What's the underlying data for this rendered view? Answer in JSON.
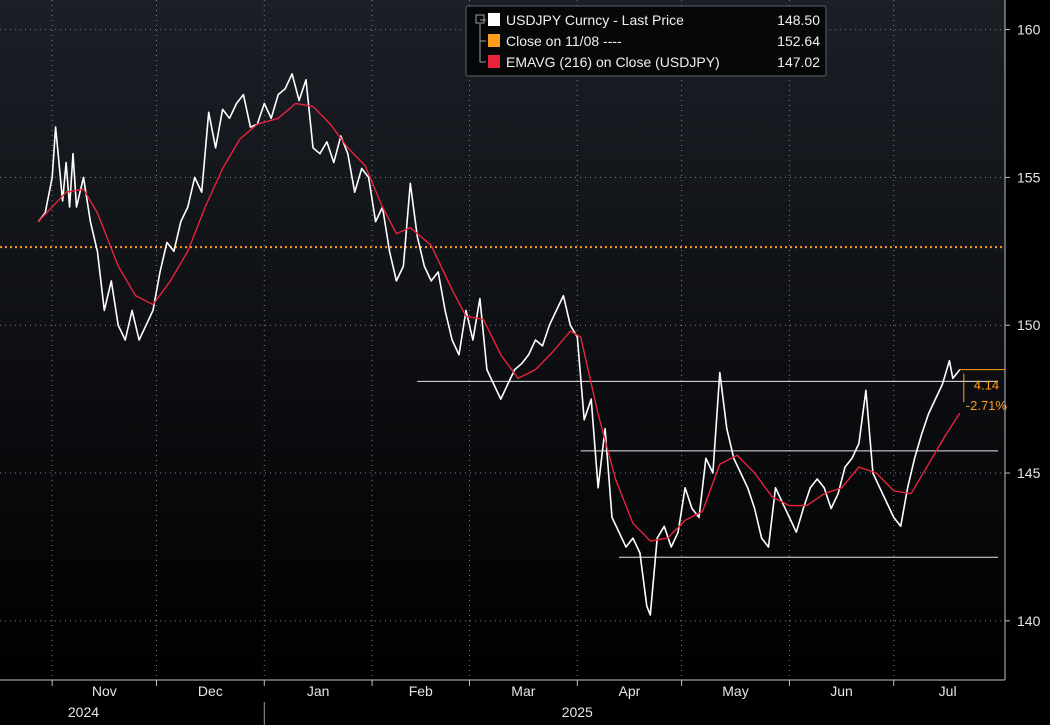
{
  "chart_data": {
    "type": "line",
    "ticker": "USDJPY",
    "ylim": [
      138,
      161
    ],
    "y_ticks": [
      140,
      145,
      150,
      155,
      160
    ],
    "month_labels": [
      "Nov",
      "Dec",
      "Jan",
      "Feb",
      "Mar",
      "Apr",
      "May",
      "Jun",
      "Jul"
    ],
    "year_labels": [
      "2024",
      "2025"
    ],
    "legend": [
      {
        "label": "USDJPY Curncy - Last Price",
        "value": "148.50",
        "color": "#ffffff"
      },
      {
        "label": "Close on 11/08 ----",
        "value": "152.64",
        "color": "#ff9e1b"
      },
      {
        "label": "EMAVG (216)  on Close (USDJPY)",
        "value": "147.02",
        "color": "#e8233c"
      }
    ],
    "annotations": {
      "change_abs": "4.14",
      "change_pct": "-2.71%"
    },
    "reference_close": 152.64,
    "support_resistance_levels": [
      148.1,
      145.75,
      142.15
    ],
    "series": [
      {
        "name": "USDJPY Curncy - Last Price",
        "color": "#ffffff",
        "points": [
          [
            "2024-10-28",
            153.5
          ],
          [
            "2024-10-30",
            153.8
          ],
          [
            "2024-11-01",
            155.0
          ],
          [
            "2024-11-02",
            156.7
          ],
          [
            "2024-11-04",
            154.2
          ],
          [
            "2024-11-05",
            155.5
          ],
          [
            "2024-11-06",
            154.0
          ],
          [
            "2024-11-07",
            155.8
          ],
          [
            "2024-11-08",
            154.0
          ],
          [
            "2024-11-10",
            155.0
          ],
          [
            "2024-11-12",
            153.5
          ],
          [
            "2024-11-14",
            152.5
          ],
          [
            "2024-11-16",
            150.5
          ],
          [
            "2024-11-18",
            151.5
          ],
          [
            "2024-11-20",
            150.0
          ],
          [
            "2024-11-22",
            149.5
          ],
          [
            "2024-11-24",
            150.5
          ],
          [
            "2024-11-26",
            149.5
          ],
          [
            "2024-11-28",
            150.0
          ],
          [
            "2024-11-30",
            150.5
          ],
          [
            "2024-12-02",
            151.8
          ],
          [
            "2024-12-04",
            152.8
          ],
          [
            "2024-12-06",
            152.5
          ],
          [
            "2024-12-08",
            153.5
          ],
          [
            "2024-12-10",
            154.0
          ],
          [
            "2024-12-12",
            155.0
          ],
          [
            "2024-12-14",
            154.5
          ],
          [
            "2024-12-16",
            157.2
          ],
          [
            "2024-12-18",
            156.0
          ],
          [
            "2024-12-20",
            157.3
          ],
          [
            "2024-12-22",
            157.0
          ],
          [
            "2024-12-24",
            157.5
          ],
          [
            "2024-12-26",
            157.8
          ],
          [
            "2024-12-28",
            156.7
          ],
          [
            "2024-12-30",
            156.8
          ],
          [
            "2025-01-01",
            157.5
          ],
          [
            "2025-01-03",
            157.0
          ],
          [
            "2025-01-05",
            157.8
          ],
          [
            "2025-01-07",
            158.0
          ],
          [
            "2025-01-09",
            158.5
          ],
          [
            "2025-01-11",
            157.6
          ],
          [
            "2025-01-13",
            158.3
          ],
          [
            "2025-01-15",
            156.0
          ],
          [
            "2025-01-17",
            155.8
          ],
          [
            "2025-01-19",
            156.2
          ],
          [
            "2025-01-21",
            155.5
          ],
          [
            "2025-01-23",
            156.4
          ],
          [
            "2025-01-25",
            155.8
          ],
          [
            "2025-01-27",
            154.5
          ],
          [
            "2025-01-29",
            155.3
          ],
          [
            "2025-01-31",
            155.0
          ],
          [
            "2025-02-02",
            153.5
          ],
          [
            "2025-02-04",
            154.0
          ],
          [
            "2025-02-06",
            152.5
          ],
          [
            "2025-02-08",
            151.5
          ],
          [
            "2025-02-10",
            152.0
          ],
          [
            "2025-02-12",
            154.8
          ],
          [
            "2025-02-14",
            153.0
          ],
          [
            "2025-02-16",
            152.0
          ],
          [
            "2025-02-18",
            151.5
          ],
          [
            "2025-02-20",
            151.8
          ],
          [
            "2025-02-22",
            150.5
          ],
          [
            "2025-02-24",
            149.5
          ],
          [
            "2025-02-26",
            149.0
          ],
          [
            "2025-02-28",
            150.5
          ],
          [
            "2025-03-02",
            149.5
          ],
          [
            "2025-03-04",
            150.9
          ],
          [
            "2025-03-06",
            148.5
          ],
          [
            "2025-03-08",
            148.0
          ],
          [
            "2025-03-10",
            147.5
          ],
          [
            "2025-03-12",
            148.0
          ],
          [
            "2025-03-14",
            148.5
          ],
          [
            "2025-03-16",
            148.7
          ],
          [
            "2025-03-18",
            149.0
          ],
          [
            "2025-03-20",
            149.5
          ],
          [
            "2025-03-22",
            149.3
          ],
          [
            "2025-03-24",
            150.0
          ],
          [
            "2025-03-26",
            150.5
          ],
          [
            "2025-03-28",
            151.0
          ],
          [
            "2025-03-30",
            150.0
          ],
          [
            "2025-04-01",
            149.6
          ],
          [
            "2025-04-03",
            146.8
          ],
          [
            "2025-04-05",
            147.5
          ],
          [
            "2025-04-07",
            144.5
          ],
          [
            "2025-04-09",
            146.5
          ],
          [
            "2025-04-11",
            143.5
          ],
          [
            "2025-04-13",
            143.0
          ],
          [
            "2025-04-15",
            142.5
          ],
          [
            "2025-04-17",
            142.8
          ],
          [
            "2025-04-19",
            142.3
          ],
          [
            "2025-04-21",
            140.5
          ],
          [
            "2025-04-22",
            140.2
          ],
          [
            "2025-04-24",
            142.8
          ],
          [
            "2025-04-26",
            143.2
          ],
          [
            "2025-04-28",
            142.5
          ],
          [
            "2025-04-30",
            143.0
          ],
          [
            "2025-05-02",
            144.5
          ],
          [
            "2025-05-04",
            143.8
          ],
          [
            "2025-05-06",
            143.5
          ],
          [
            "2025-05-08",
            145.5
          ],
          [
            "2025-05-10",
            145.0
          ],
          [
            "2025-05-12",
            148.4
          ],
          [
            "2025-05-14",
            146.5
          ],
          [
            "2025-05-16",
            145.5
          ],
          [
            "2025-05-18",
            145.0
          ],
          [
            "2025-05-20",
            144.5
          ],
          [
            "2025-05-22",
            143.8
          ],
          [
            "2025-05-24",
            142.8
          ],
          [
            "2025-05-26",
            142.5
          ],
          [
            "2025-05-28",
            144.5
          ],
          [
            "2025-05-30",
            144.0
          ],
          [
            "2025-06-01",
            143.5
          ],
          [
            "2025-06-03",
            143.0
          ],
          [
            "2025-06-05",
            143.8
          ],
          [
            "2025-06-07",
            144.5
          ],
          [
            "2025-06-09",
            144.8
          ],
          [
            "2025-06-11",
            144.5
          ],
          [
            "2025-06-13",
            143.8
          ],
          [
            "2025-06-15",
            144.3
          ],
          [
            "2025-06-17",
            145.2
          ],
          [
            "2025-06-19",
            145.5
          ],
          [
            "2025-06-21",
            146.0
          ],
          [
            "2025-06-23",
            147.8
          ],
          [
            "2025-06-25",
            145.0
          ],
          [
            "2025-06-27",
            144.5
          ],
          [
            "2025-06-29",
            144.0
          ],
          [
            "2025-07-01",
            143.5
          ],
          [
            "2025-07-03",
            143.2
          ],
          [
            "2025-07-05",
            144.5
          ],
          [
            "2025-07-07",
            145.5
          ],
          [
            "2025-07-09",
            146.3
          ],
          [
            "2025-07-11",
            147.0
          ],
          [
            "2025-07-13",
            147.5
          ],
          [
            "2025-07-15",
            148.0
          ],
          [
            "2025-07-17",
            148.8
          ],
          [
            "2025-07-18",
            148.2
          ],
          [
            "2025-07-20",
            148.5
          ]
        ]
      },
      {
        "name": "EMAVG (216)  on Close (USDJPY)",
        "color": "#e8233c",
        "points": [
          [
            "2024-10-28",
            153.5
          ],
          [
            "2024-11-05",
            154.5
          ],
          [
            "2024-11-10",
            154.6
          ],
          [
            "2024-11-14",
            153.8
          ],
          [
            "2024-11-20",
            152.0
          ],
          [
            "2024-11-25",
            151.0
          ],
          [
            "2024-11-30",
            150.7
          ],
          [
            "2024-12-05",
            151.5
          ],
          [
            "2024-12-10",
            152.5
          ],
          [
            "2024-12-15",
            154.0
          ],
          [
            "2024-12-20",
            155.3
          ],
          [
            "2024-12-25",
            156.3
          ],
          [
            "2024-12-30",
            156.8
          ],
          [
            "2025-01-05",
            157.0
          ],
          [
            "2025-01-10",
            157.5
          ],
          [
            "2025-01-15",
            157.4
          ],
          [
            "2025-01-20",
            156.8
          ],
          [
            "2025-01-25",
            156.0
          ],
          [
            "2025-01-30",
            155.4
          ],
          [
            "2025-02-04",
            154.0
          ],
          [
            "2025-02-08",
            153.1
          ],
          [
            "2025-02-12",
            153.3
          ],
          [
            "2025-02-18",
            152.7
          ],
          [
            "2025-02-24",
            151.2
          ],
          [
            "2025-02-28",
            150.3
          ],
          [
            "2025-03-05",
            150.2
          ],
          [
            "2025-03-10",
            149.0
          ],
          [
            "2025-03-15",
            148.2
          ],
          [
            "2025-03-20",
            148.5
          ],
          [
            "2025-03-25",
            149.1
          ],
          [
            "2025-03-30",
            149.8
          ],
          [
            "2025-04-02",
            149.6
          ],
          [
            "2025-04-07",
            147.0
          ],
          [
            "2025-04-12",
            144.8
          ],
          [
            "2025-04-17",
            143.3
          ],
          [
            "2025-04-22",
            142.7
          ],
          [
            "2025-04-27",
            142.8
          ],
          [
            "2025-05-02",
            143.4
          ],
          [
            "2025-05-07",
            143.7
          ],
          [
            "2025-05-12",
            145.3
          ],
          [
            "2025-05-17",
            145.6
          ],
          [
            "2025-05-22",
            145.0
          ],
          [
            "2025-05-27",
            144.2
          ],
          [
            "2025-06-01",
            143.9
          ],
          [
            "2025-06-06",
            143.9
          ],
          [
            "2025-06-11",
            144.3
          ],
          [
            "2025-06-16",
            144.5
          ],
          [
            "2025-06-21",
            145.2
          ],
          [
            "2025-06-26",
            145.0
          ],
          [
            "2025-07-01",
            144.4
          ],
          [
            "2025-07-06",
            144.3
          ],
          [
            "2025-07-11",
            145.3
          ],
          [
            "2025-07-16",
            146.3
          ],
          [
            "2025-07-20",
            147.02
          ]
        ]
      }
    ]
  }
}
